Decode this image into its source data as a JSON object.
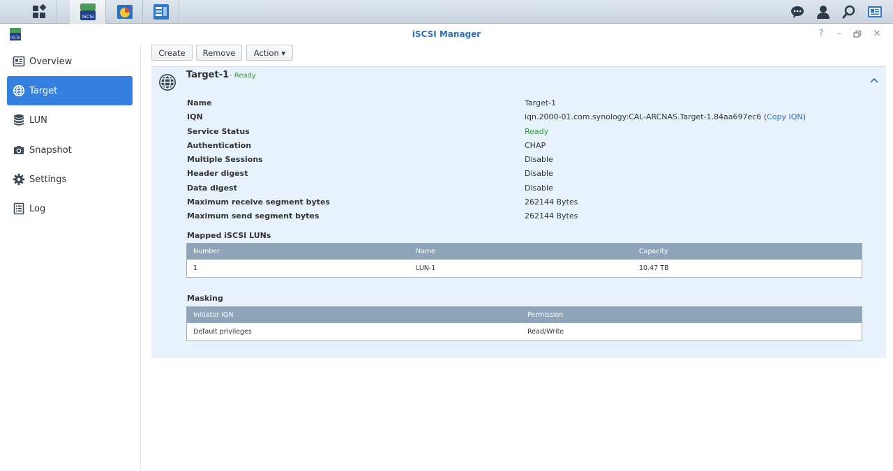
{
  "taskbar": {
    "apps": [
      {
        "name": "main-menu",
        "icon": "grid-icon"
      },
      {
        "name": "iscsi-manager",
        "icon": "iscsi-icon",
        "label": "iSCSI"
      },
      {
        "name": "storage-manager",
        "icon": "storage-pie-icon"
      },
      {
        "name": "control-panel",
        "icon": "panel-icon"
      }
    ],
    "right_icons": [
      "chat-icon",
      "user-icon",
      "search-icon",
      "widgets-icon"
    ]
  },
  "window": {
    "title": "iSCSI Manager",
    "icon_label": "iSCSI",
    "controls": [
      "help-icon",
      "minimize-icon",
      "restore-icon",
      "close-icon"
    ]
  },
  "sidebar": {
    "items": [
      {
        "label": "Overview",
        "icon": "overview-icon",
        "active": false
      },
      {
        "label": "Target",
        "icon": "globe-icon",
        "active": true
      },
      {
        "label": "LUN",
        "icon": "database-icon",
        "active": false
      },
      {
        "label": "Snapshot",
        "icon": "camera-icon",
        "active": false
      },
      {
        "label": "Settings",
        "icon": "gear-icon",
        "active": false
      },
      {
        "label": "Log",
        "icon": "log-icon",
        "active": false
      }
    ]
  },
  "toolbar": {
    "create": "Create",
    "remove": "Remove",
    "action": "Action ▾"
  },
  "target": {
    "name": "Target-1",
    "status": "- Ready",
    "properties": [
      {
        "label": "Name",
        "value": "Target-1"
      },
      {
        "label": "IQN",
        "value": "iqn.2000-01.com.synology:CAL-ARCNAS.Target-1.84aa697ec6",
        "link_prefix": " (",
        "link": "Copy IQN",
        "link_suffix": ")"
      },
      {
        "label": "Service Status",
        "value": "Ready"
      },
      {
        "label": "Authentication",
        "value": "CHAP"
      },
      {
        "label": "Multiple Sessions",
        "value": "Disable"
      },
      {
        "label": "Header digest",
        "value": "Disable"
      },
      {
        "label": "Data digest",
        "value": "Disable"
      },
      {
        "label": "Maximum receive segment bytes",
        "value": "262144 Bytes"
      },
      {
        "label": "Maximum send segment bytes",
        "value": "262144 Bytes"
      }
    ],
    "luns": {
      "title": "Mapped iSCSI LUNs",
      "columns": [
        "Number",
        "Name",
        "Capacity"
      ],
      "rows": [
        [
          "1",
          "LUN-1",
          "10.47 TB"
        ]
      ]
    },
    "masking": {
      "title": "Masking",
      "columns": [
        "Initiator IQN",
        "Permission"
      ],
      "rows": [
        [
          "Default privileges",
          "Read/Write"
        ]
      ]
    }
  },
  "colors": {
    "accent": "#3580de",
    "ready_green": "#2e9c34",
    "panel_bg": "#e8f2fd",
    "grid_header": "#8ea4b9"
  }
}
